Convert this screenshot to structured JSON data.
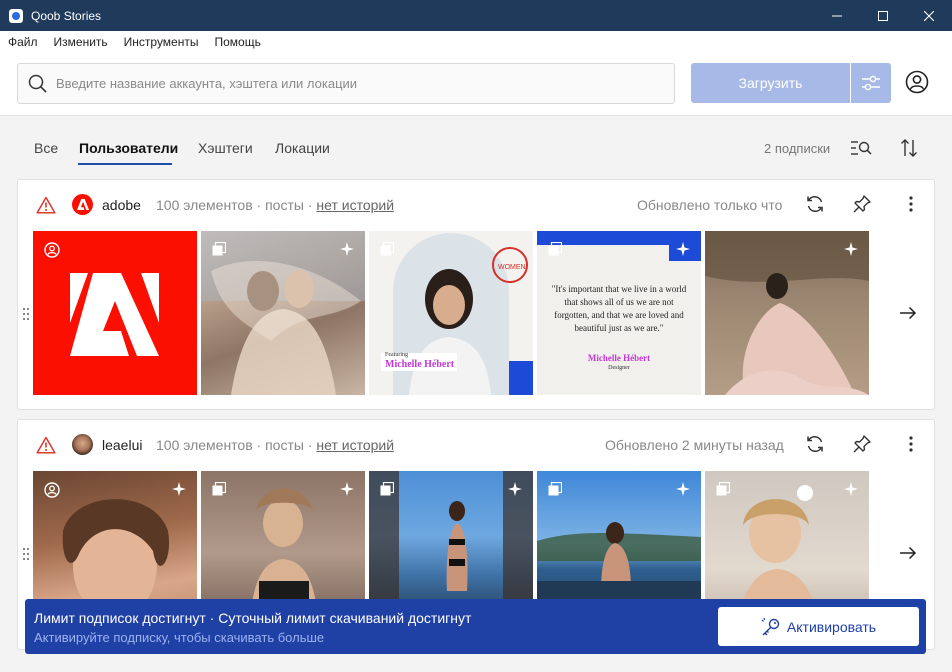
{
  "window": {
    "title": "Qoob Stories"
  },
  "menu": {
    "items": [
      "Файл",
      "Изменить",
      "Инструменты",
      "Помощь"
    ]
  },
  "search": {
    "placeholder": "Введите название аккаунта, хэштега или локации",
    "value": ""
  },
  "toolbar": {
    "download_label": "Загрузить"
  },
  "tabs": {
    "items": [
      "Все",
      "Пользователи",
      "Хэштеги",
      "Локации"
    ],
    "active": "Пользователи"
  },
  "subscriptions": {
    "count_label": "2 подписки"
  },
  "accounts": [
    {
      "username": "adobe",
      "meta": "100 элементов · посты ·",
      "stories": "нет историй",
      "updated": "Обновлено только что",
      "thumbnails": [
        {
          "kind": "profile",
          "alt": "Adobe logo"
        },
        {
          "kind": "post",
          "alt": "woman in sheer fabric"
        },
        {
          "kind": "post",
          "caption": "Michelle Hébert",
          "caption_prefix": "Featuring"
        },
        {
          "kind": "post",
          "quote": "\"It's important that we live in a world that shows all of us we are not forgotten, and that we are loved and beautiful just as we are.\"",
          "author": "Michelle Hébert",
          "author_role": "Designer"
        },
        {
          "kind": "post",
          "alt": "woman in pink dress outdoors"
        }
      ]
    },
    {
      "username": "leaelui",
      "meta": "100 элементов · посты ·",
      "stories": "нет историй",
      "updated": "Обновлено 2 минуты назад",
      "thumbnails": [
        {
          "kind": "profile",
          "alt": "portrait"
        },
        {
          "kind": "post",
          "alt": "woman in bath"
        },
        {
          "kind": "post",
          "alt": "woman by the sea"
        },
        {
          "kind": "post",
          "alt": "woman in pool"
        },
        {
          "kind": "post",
          "alt": "smiling woman"
        }
      ]
    }
  ],
  "banner": {
    "title": "Лимит подписок достигнут · Суточный лимит скачиваний достигнут",
    "subtitle": "Активируйте подписку, чтобы скачивать больше",
    "activate_label": "Активировать"
  },
  "colors": {
    "titlebar": "#1f3a5a",
    "accent": "#1f40a5",
    "download_disabled": "#a7b9e6",
    "warning": "#e0372c",
    "adobe_red": "#fa0f00"
  },
  "icons": [
    "app-icon",
    "minimize-icon",
    "maximize-icon",
    "close-icon",
    "search-icon",
    "filter-icon",
    "account-icon",
    "list-search-icon",
    "sort-icon",
    "warning-icon",
    "refresh-icon",
    "pin-icon",
    "more-icon",
    "drag-handle-icon",
    "arrow-right-icon",
    "profile-badge-icon",
    "multi-photo-icon",
    "sparkle-icon",
    "key-icon"
  ]
}
